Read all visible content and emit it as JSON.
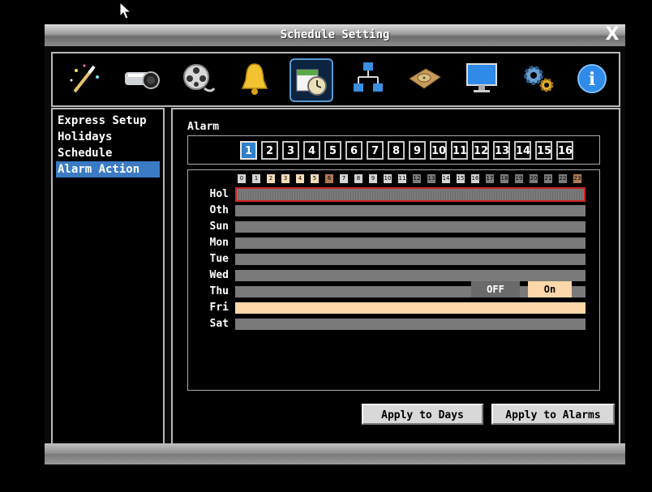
{
  "window": {
    "title": "Schedule Setting",
    "close_glyph": "X"
  },
  "toolbar": {
    "icons": [
      "magic-wand-icon",
      "camera-icon",
      "film-reel-icon",
      "bell-icon",
      "calendar-clock-icon",
      "network-icon",
      "hard-disk-icon",
      "monitor-icon",
      "gears-icon",
      "info-icon"
    ],
    "selected_index": 4
  },
  "menu": {
    "items": [
      "Express Setup",
      "Holidays",
      "Schedule",
      "Alarm Action"
    ],
    "selected_index": 3
  },
  "alarm": {
    "label": "Alarm",
    "buttons": [
      "1",
      "2",
      "3",
      "4",
      "5",
      "6",
      "7",
      "8",
      "9",
      "10",
      "11",
      "12",
      "13",
      "14",
      "15",
      "16"
    ],
    "selected": "1"
  },
  "schedule": {
    "hours": [
      "0",
      "1",
      "2",
      "3",
      "4",
      "5",
      "6",
      "7",
      "8",
      "9",
      "10",
      "11",
      "12",
      "13",
      "14",
      "15",
      "16",
      "17",
      "18",
      "19",
      "20",
      "21",
      "22",
      "23"
    ],
    "days": [
      "Hol",
      "Oth",
      "Sun",
      "Mon",
      "Tue",
      "Wed",
      "Thu",
      "Fri",
      "Sat"
    ],
    "day_states": [
      "off",
      "off",
      "off",
      "off",
      "off",
      "off",
      "off",
      "on",
      "off"
    ],
    "cursor_day": "Hol",
    "legend_off": "OFF",
    "legend_on": "On"
  },
  "actions": {
    "apply_days": "Apply to Days",
    "apply_alarms": "Apply to Alarms"
  },
  "colors": {
    "on": "#fcd7a9",
    "off": "#7a7a7a",
    "accent": "#3b7bc4",
    "cursor": "#d02424"
  }
}
